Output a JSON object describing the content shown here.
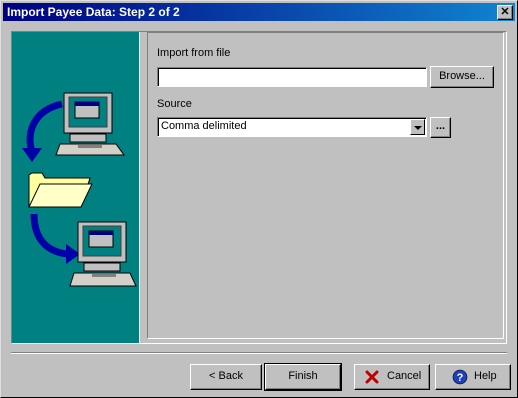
{
  "window": {
    "title": "Import Payee Data: Step 2 of 2",
    "close_glyph": "✕"
  },
  "form": {
    "import_label": "Import from file",
    "import_value": "",
    "browse_label": "Browse...",
    "source_label": "Source",
    "source_value": "Comma delimited",
    "source_more_label": "..."
  },
  "footer": {
    "back_label": "< Back",
    "finish_label": "Finish",
    "cancel_label": "Cancel",
    "help_label": "Help"
  },
  "colors": {
    "title_gradient_start": "#000080",
    "title_gradient_end": "#1084d0",
    "sidebar": "#008080",
    "cancel_icon": "#c00000",
    "help_icon": "#1f3fbf"
  },
  "icons": [
    "computer-icon",
    "folder-icon",
    "transfer-arrow-icon",
    "close-icon",
    "cancel-x-icon",
    "help-icon"
  ]
}
